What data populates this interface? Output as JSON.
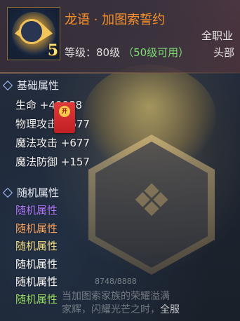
{
  "item": {
    "title": "龙语 · 加图索誓约",
    "class_req": "全职业",
    "level_text": "等级：80级",
    "level_avail": "（50级可用）",
    "slot": "头部",
    "icon_level": "5",
    "badge_text": "开"
  },
  "base_section": {
    "label": "基础属性",
    "stats": [
      "生命 +40088",
      "物理攻击 +677",
      "魔法攻击 +677",
      "魔法防御 +157"
    ]
  },
  "random_section": {
    "label": "随机属性",
    "items": [
      {
        "text": "随机属性",
        "color": "#b17bff"
      },
      {
        "text": "随机属性",
        "color": "#ffab67"
      },
      {
        "text": "随机属性",
        "color": "#f3e08a"
      },
      {
        "text": "随机属性",
        "color": "#ffffff"
      },
      {
        "text": "随机属性",
        "color": "#ffffff"
      },
      {
        "text": "随机属性",
        "color": "#9be06b"
      }
    ]
  },
  "durability": "8748/8888",
  "flavor": {
    "line1": "当加图索家族的荣耀溢满",
    "line2a": "家辉，闪耀光芒之时，",
    "line2b": "全服"
  },
  "colors": {
    "title": "#f6902c",
    "available": "#7fdc74"
  }
}
